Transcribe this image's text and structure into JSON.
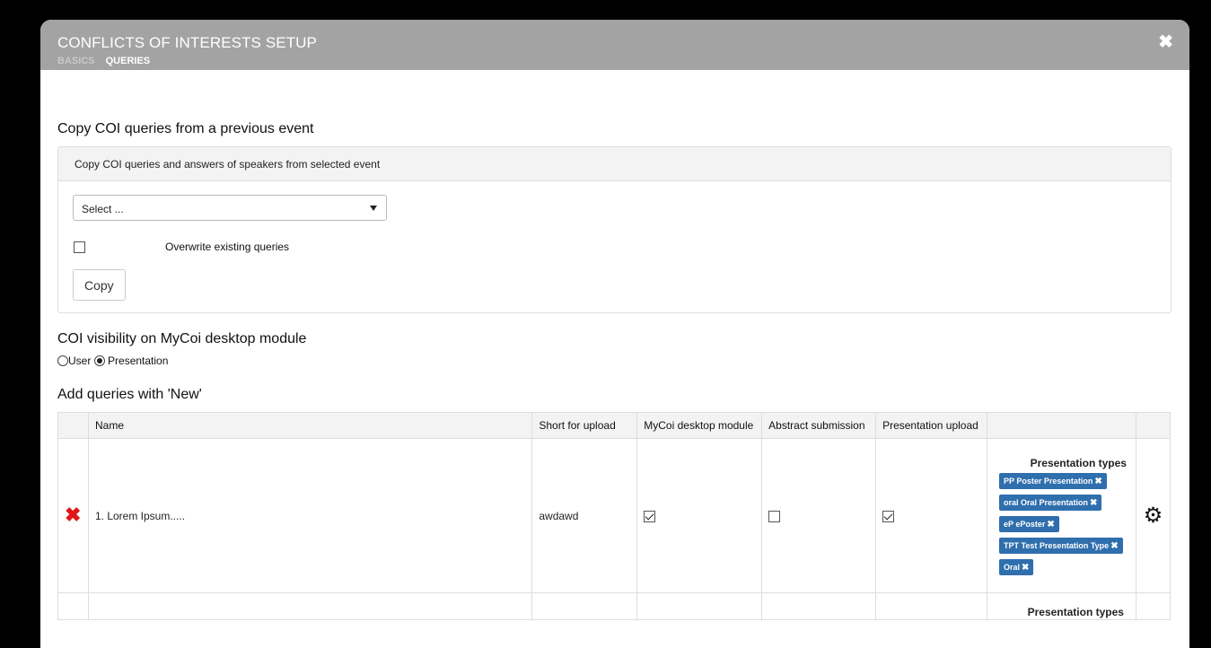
{
  "modal": {
    "title": "CONFLICTS OF INTERESTS SETUP",
    "breadcrumb": [
      "BASICS",
      "QUERIES"
    ],
    "close_icon": "close-icon"
  },
  "copy_section": {
    "heading": "Copy COI queries from a previous event",
    "panel_heading": "Copy COI queries and answers of speakers from selected event",
    "select_value": "Select ...",
    "overwrite_label": "Overwrite existing queries",
    "overwrite_checked": false,
    "copy_button": "Copy"
  },
  "visibility_section": {
    "heading": "COI visibility on MyCoi desktop module",
    "options": [
      {
        "label": "User",
        "selected": false
      },
      {
        "label": "Presentation",
        "selected": true
      }
    ]
  },
  "queries_section": {
    "heading": "Add queries with 'New'",
    "columns": [
      "",
      "Name",
      "Short for upload",
      "MyCoi desktop module",
      "Abstract submission",
      "Presentation upload",
      "",
      ""
    ],
    "rows": [
      {
        "name": "1. Lorem Ipsum.....",
        "short": "awdawd",
        "mycoi": true,
        "abstract": false,
        "presentation": true,
        "types_title": "Presentation types",
        "types": [
          "PP Poster Presentation",
          "oral Oral Presentation",
          "eP ePoster",
          "TPT Test Presentation Type",
          "Oral"
        ]
      }
    ],
    "next_row_types_title": "Presentation types"
  },
  "colors": {
    "header_bg": "#a3a3a3",
    "tag_bg": "#2f6fad",
    "delete_red": "#e01515"
  }
}
